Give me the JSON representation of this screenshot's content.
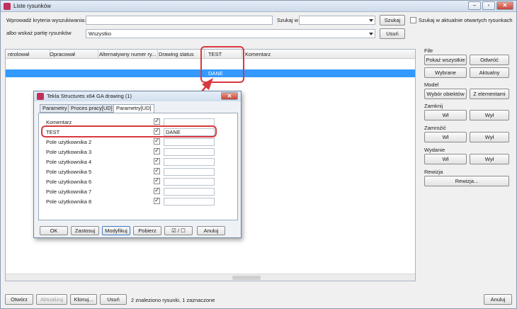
{
  "window": {
    "title": "Liste rysunków"
  },
  "search": {
    "criteria_label": "Wprowadź kryteria wyszukiwania:",
    "criteria_value": "",
    "search_in_label": "Szukaj w",
    "search_in_value": "",
    "search_button": "Szukaj",
    "open_drawings_label": "Szukaj w aktualnie otwartych rysunkach",
    "part_label": "albo wskaż partię rysunków",
    "part_value": "Wszystko",
    "remove_button": "Usuń"
  },
  "table": {
    "columns": [
      "ntrolował",
      "Opracował",
      "Alternatywny numer ry...",
      "Drawing status",
      "TEST",
      "Komentarz"
    ],
    "rows": [
      {
        "test": "DANE"
      }
    ]
  },
  "filters": {
    "filtr": {
      "label": "Filtr",
      "show_all": "Pokaż wszystkie",
      "invert": "Odwróć",
      "selected": "Wybrane",
      "current": "Aktualny"
    },
    "model": {
      "label": "Model",
      "select_objects": "Wybór obiektów",
      "from_elements": "Z elementami"
    },
    "zamknij": {
      "label": "Zamknij",
      "on": "Wł",
      "off": "Wył"
    },
    "zamroz": {
      "label": "Zamroźić",
      "on": "Wł",
      "off": "Wył"
    },
    "wydanie": {
      "label": "Wydanie",
      "on": "Wł",
      "off": "Wył"
    },
    "rewizja": {
      "label": "Rewizja",
      "button": "Rewizja..."
    }
  },
  "bottom": {
    "open": "Otwórz",
    "update": "Aktualizuj",
    "clone": "Klonuj...",
    "delete": "Usuń",
    "status": "2 znaleziono rysunki, 1 zaznaczone",
    "cancel": "Anuluj"
  },
  "dialog": {
    "title": "Tekla Structures x64  GA drawing (1)",
    "tabs": [
      "Parametry",
      "Proces pracy[UD]",
      "Parametry[UD]"
    ],
    "rows": [
      {
        "label": "Komentarz",
        "value": ""
      },
      {
        "label": "TEST",
        "value": "DANE"
      },
      {
        "label": "Pole użytkownika 2",
        "value": ""
      },
      {
        "label": "Pole użytkownika 3",
        "value": ""
      },
      {
        "label": "Pole użytkownika 4",
        "value": ""
      },
      {
        "label": "Pole użytkownika 5",
        "value": ""
      },
      {
        "label": "Pole użytkownika 6",
        "value": ""
      },
      {
        "label": "Pole użytkownika 7",
        "value": ""
      },
      {
        "label": "Pole użytkownika 8",
        "value": ""
      }
    ],
    "buttons": {
      "ok": "OK",
      "apply": "Zastosuj",
      "modify": "Modyfikuj",
      "get": "Pobierz",
      "toggle": "☑ / ☐",
      "cancel": "Anuluj"
    }
  },
  "colors": {
    "selection": "#3399ff",
    "highlight": "#d9383f"
  }
}
